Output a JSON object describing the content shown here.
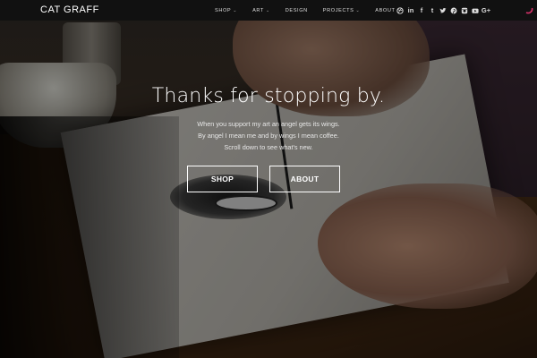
{
  "site": {
    "logo": "CAT GRAFF"
  },
  "nav": {
    "items": [
      {
        "label": "SHOP",
        "has_dropdown": true
      },
      {
        "label": "ART",
        "has_dropdown": true
      },
      {
        "label": "DESIGN",
        "has_dropdown": false
      },
      {
        "label": "PROJECTS",
        "has_dropdown": true
      },
      {
        "label": "ABOUT",
        "has_dropdown": false
      }
    ],
    "caret": "⌄"
  },
  "social": [
    {
      "name": "dribbble-icon"
    },
    {
      "name": "linkedin-icon",
      "glyph": "in"
    },
    {
      "name": "facebook-icon",
      "glyph": "f"
    },
    {
      "name": "tumblr-icon",
      "glyph": "t"
    },
    {
      "name": "twitter-icon"
    },
    {
      "name": "pinterest-icon"
    },
    {
      "name": "instagram-icon"
    },
    {
      "name": "youtube-icon"
    },
    {
      "name": "google-plus-icon",
      "glyph": "G+"
    }
  ],
  "hero": {
    "title": "Thanks for stopping by.",
    "lines": [
      "When you support my art an angel gets its wings.",
      "By angel I mean me and by wings I mean coffee.",
      "Scroll down to see what's new."
    ],
    "buttons": {
      "shop": "SHOP",
      "about": "ABOUT"
    }
  },
  "colors": {
    "navbar": "#111111",
    "accent": "#d8326a",
    "text": "#ffffff"
  }
}
